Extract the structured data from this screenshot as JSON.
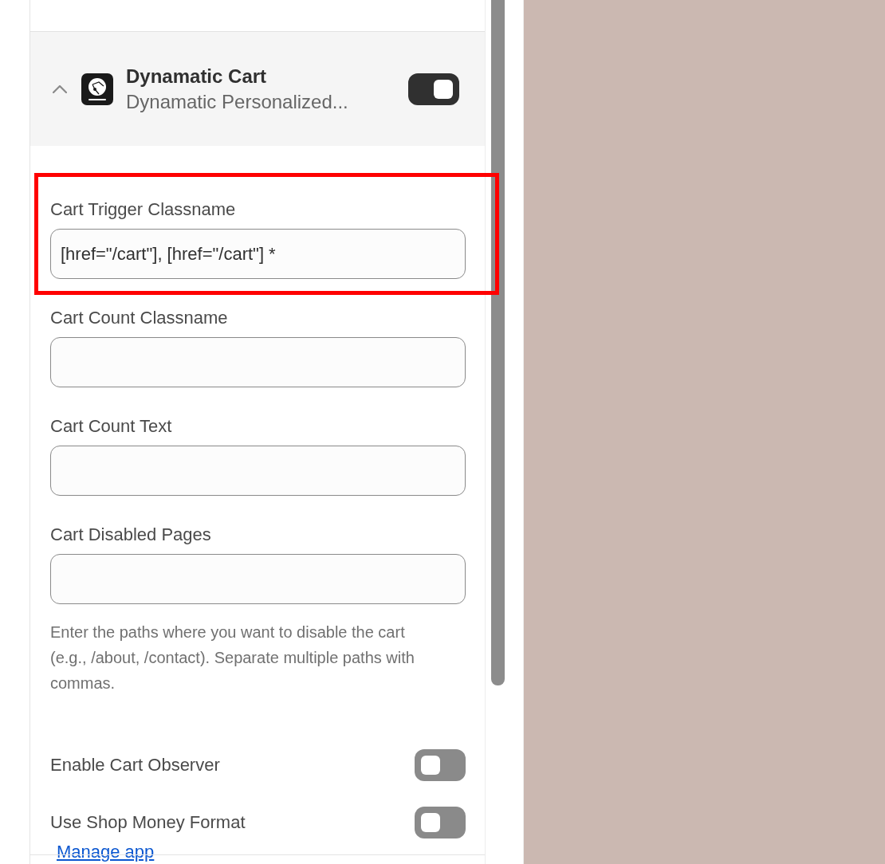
{
  "app_block": {
    "title": "Dynamatic Cart",
    "subtitle": "Dynamatic Personalized...",
    "expanded": true,
    "enabled": true
  },
  "fields": [
    {
      "label": "Cart Trigger Classname",
      "value": "[href=\"/cart\"], [href=\"/cart\"] *",
      "highlighted": true
    },
    {
      "label": "Cart Count Classname",
      "highlighted": false
    },
    {
      "label": "Cart Count Text",
      "highlighted": false
    },
    {
      "label": "Cart Disabled Pages",
      "highlighted": false,
      "help": "Enter the paths where you want to disable the cart (e.g., /about, /contact). Separate multiple paths with commas."
    }
  ],
  "toggles": [
    {
      "label": "Enable Cart Observer",
      "on": false
    },
    {
      "label": "Use Shop Money Format",
      "on": false
    }
  ],
  "link": "Manage app"
}
